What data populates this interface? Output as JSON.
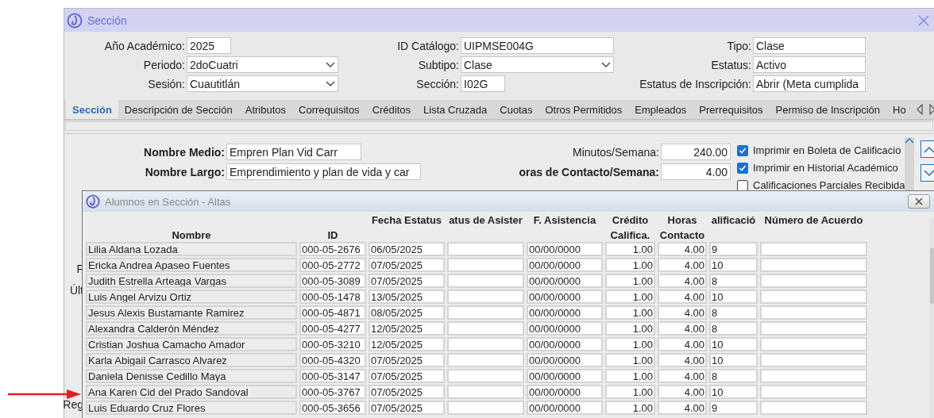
{
  "window": {
    "title": "Sección"
  },
  "header_rows": [
    [
      {
        "label": "Año Académico:",
        "value": "2025",
        "kind": "short"
      },
      {
        "label": "ID Catálogo:",
        "value": "UIPMSE004G",
        "kind": "text"
      },
      {
        "label": "Tipo:",
        "value": "Clase",
        "kind": "text"
      }
    ],
    [
      {
        "label": "Periodo:",
        "value": "2doCuatri",
        "kind": "dropdown"
      },
      {
        "label": "Subtipo:",
        "value": "Clase",
        "kind": "dropdown"
      },
      {
        "label": "Estatus:",
        "value": "Activo",
        "kind": "text"
      }
    ],
    [
      {
        "label": "Sesión:",
        "value": "Cuautitlán",
        "kind": "dropdown"
      },
      {
        "label": "Sección:",
        "value": "I02G",
        "kind": "short"
      },
      {
        "label": "Estatus de Inscripción:",
        "value": "Abrir (Meta cumplida",
        "kind": "text"
      }
    ]
  ],
  "tabs": [
    {
      "label": "Sección",
      "selected": true
    },
    {
      "label": "Descripción de Sección",
      "selected": false
    },
    {
      "label": "Atributos",
      "selected": false
    },
    {
      "label": "Correquisitos",
      "selected": false
    },
    {
      "label": "Créditos",
      "selected": false
    },
    {
      "label": "Lista Cruzada",
      "selected": false
    },
    {
      "label": "Cuotas",
      "selected": false
    },
    {
      "label": "Otros Permitidos",
      "selected": false
    },
    {
      "label": "Empleados",
      "selected": false
    },
    {
      "label": "Prerrequisitos",
      "selected": false
    },
    {
      "label": "Permiso de Inscripción",
      "selected": false
    },
    {
      "label": "Ho",
      "selected": false
    }
  ],
  "section_panel": {
    "left_fields": [
      {
        "label": "Nombre Medio:",
        "value": "Empren Plan Vid Carr",
        "kind": "short"
      },
      {
        "label": "Nombre Largo:",
        "value": "Emprendimiento y plan de vida y car",
        "kind": "long"
      }
    ],
    "right_fields": [
      {
        "label": "Minutos/Semana:",
        "value": "240.00",
        "bold": false
      },
      {
        "label": "oras de Contacto/Semana:",
        "value": "4.00",
        "bold": true
      }
    ],
    "checkboxes": [
      {
        "label": "Imprimir en Boleta de Calificacio",
        "checked": true
      },
      {
        "label": "Imprimir en Historial Académico",
        "checked": true
      },
      {
        "label": "Calificaciones Parciales Recibida",
        "checked": false
      }
    ],
    "partial_labels": [
      "F",
      "Últ",
      "Reg"
    ]
  },
  "dialog": {
    "title": "Alumnos en Sección - Altas",
    "columns": [
      {
        "bottom": "Nombre"
      },
      {
        "bottom": "ID"
      },
      {
        "top": "Fecha Estatus"
      },
      {
        "top": "atus de Asister"
      },
      {
        "top": "F. Asistencia"
      },
      {
        "top": "Crédito",
        "bottom": "Califica."
      },
      {
        "top": "Horas",
        "bottom": "Contacto"
      },
      {
        "top": "alificació"
      },
      {
        "top": "Número de Acuerdo"
      }
    ],
    "rows": [
      {
        "name": "Lilia Aldana Lozada",
        "id": "000-05-2676",
        "status_date": "06/05/2025",
        "attendance_date": "00/00/0000",
        "credit": "1.00",
        "hours": "4.00",
        "grade": "9"
      },
      {
        "name": "Ericka Andrea Apaseo Fuentes",
        "id": "000-05-2772",
        "status_date": "07/05/2025",
        "attendance_date": "00/00/0000",
        "credit": "1.00",
        "hours": "4.00",
        "grade": "10"
      },
      {
        "name": "Judith Estrella Arteaga Vargas",
        "id": "000-05-3089",
        "status_date": "07/05/2025",
        "attendance_date": "00/00/0000",
        "credit": "1.00",
        "hours": "4.00",
        "grade": "8"
      },
      {
        "name": "Luis Angel Arvizu Ortiz",
        "id": "000-05-1478",
        "status_date": "13/05/2025",
        "attendance_date": "00/00/0000",
        "credit": "1.00",
        "hours": "4.00",
        "grade": "10"
      },
      {
        "name": "Jesus Alexis Bustamante Ramirez",
        "id": "000-05-4871",
        "status_date": "08/05/2025",
        "attendance_date": "00/00/0000",
        "credit": "1.00",
        "hours": "4.00",
        "grade": "8"
      },
      {
        "name": "Alexandra Calderón Méndez",
        "id": "000-05-4277",
        "status_date": "12/05/2025",
        "attendance_date": "00/00/0000",
        "credit": "1.00",
        "hours": "4.00",
        "grade": "8"
      },
      {
        "name": "Cristian Joshua Camacho Amador",
        "id": "000-05-3210",
        "status_date": "12/05/2025",
        "attendance_date": "00/00/0000",
        "credit": "1.00",
        "hours": "4.00",
        "grade": "10"
      },
      {
        "name": "Karla Abigail Carrasco Alvarez",
        "id": "000-05-4320",
        "status_date": "07/05/2025",
        "attendance_date": "00/00/0000",
        "credit": "1.00",
        "hours": "4.00",
        "grade": "10"
      },
      {
        "name": "Daniela Denisse Cedillo Maya",
        "id": "000-05-3147",
        "status_date": "07/05/2025",
        "attendance_date": "00/00/0000",
        "credit": "1.00",
        "hours": "4.00",
        "grade": "8"
      },
      {
        "name": "Ana Karen Cid del Prado Sandoval",
        "id": "000-05-3767",
        "status_date": "07/05/2025",
        "attendance_date": "00/00/0000",
        "credit": "1.00",
        "hours": "4.00",
        "grade": "10"
      },
      {
        "name": "Luis Eduardo Cruz Flores",
        "id": "000-05-3656",
        "status_date": "07/05/2025",
        "attendance_date": "00/00/0000",
        "credit": "1.00",
        "hours": "4.00",
        "grade": "9"
      }
    ]
  }
}
